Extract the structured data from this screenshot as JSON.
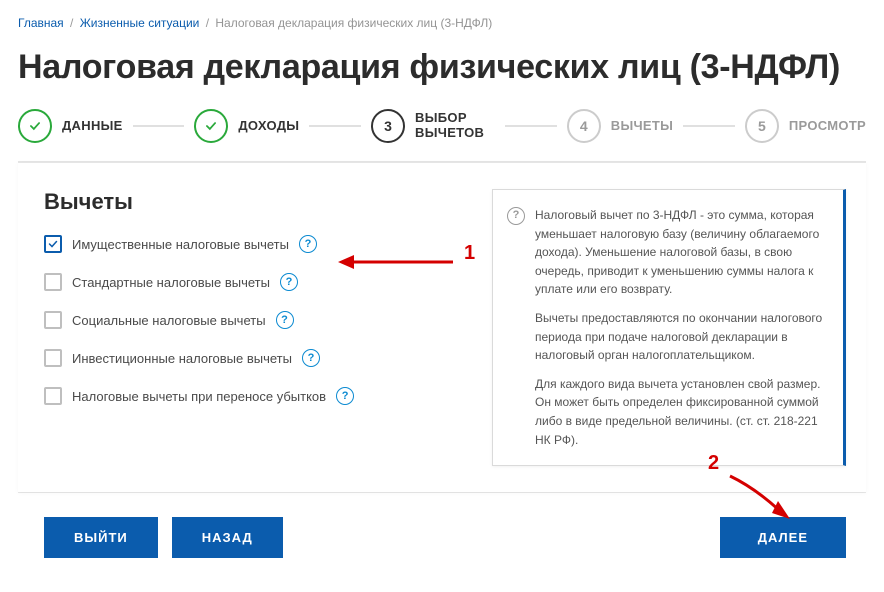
{
  "breadcrumb": {
    "home": "Главная",
    "situations": "Жизненные ситуации",
    "current": "Налоговая декларация физических лиц (3-НДФЛ)"
  },
  "page_title": "Налоговая декларация физических лиц (3-НДФЛ)",
  "steps": {
    "s1": {
      "label": "ДАННЫЕ"
    },
    "s2": {
      "label": "ДОХОДЫ"
    },
    "s3": {
      "num": "3",
      "label": "ВЫБОР ВЫЧЕТОВ"
    },
    "s4": {
      "num": "4",
      "label": "ВЫЧЕТЫ"
    },
    "s5": {
      "num": "5",
      "label": "ПРОСМОТР"
    }
  },
  "section_title": "Вычеты",
  "checkboxes": {
    "c1": {
      "label": "Имущественные налоговые вычеты",
      "checked": true
    },
    "c2": {
      "label": "Стандартные налоговые вычеты",
      "checked": false
    },
    "c3": {
      "label": "Социальные налоговые вычеты",
      "checked": false
    },
    "c4": {
      "label": "Инвестиционные налоговые вычеты",
      "checked": false
    },
    "c5": {
      "label": "Налоговые вычеты при переносе убытков",
      "checked": false
    }
  },
  "info": {
    "p1": "Налоговый вычет по 3-НДФЛ - это сумма, которая уменьшает налоговую базу (величину облагаемого дохода). Уменьшение налоговой базы, в свою очередь, приводит к уменьшению суммы налога к уплате или его возврату.",
    "p2": "Вычеты предоставляются по окончании налогового периода при подаче налоговой декларации в налоговый орган налогоплательщиком.",
    "p3": "Для каждого вида вычета установлен свой размер. Он может быть определен фиксированной суммой либо в виде предельной величины. (ст. ст. 218-221 НК РФ)."
  },
  "buttons": {
    "exit": "ВЫЙТИ",
    "back": "НАЗАД",
    "next": "ДАЛЕЕ"
  },
  "annotations": {
    "a1": "1",
    "a2": "2"
  }
}
